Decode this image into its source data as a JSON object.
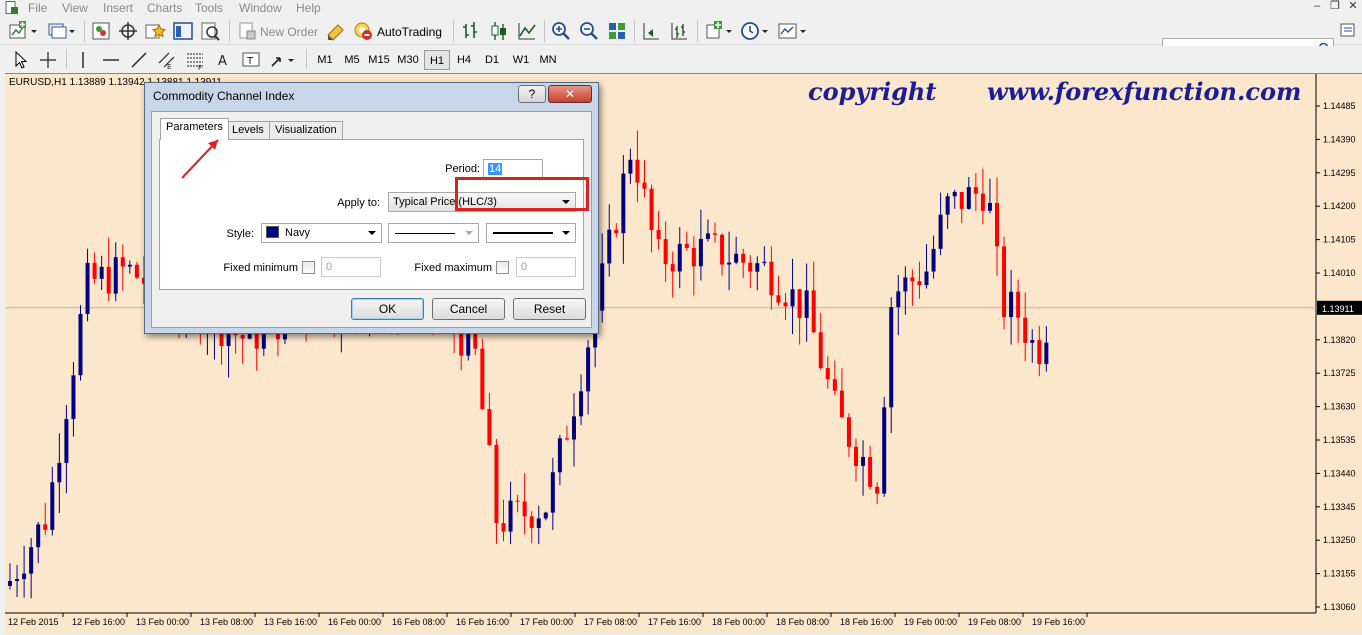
{
  "menu": {
    "items": [
      "File",
      "View",
      "Insert",
      "Charts",
      "Tools",
      "Window",
      "Help"
    ]
  },
  "window_controls": {
    "minimize": "–",
    "restore": "❐",
    "close": "✕"
  },
  "toolbar": {
    "new_order": "New Order",
    "autotrading": "AutoTrading"
  },
  "timeframes": [
    "M1",
    "M5",
    "M15",
    "M30",
    "H1",
    "H4",
    "D1",
    "W1",
    "MN"
  ],
  "active_timeframe": "H1",
  "search": {
    "placeholder": ""
  },
  "chart": {
    "symbol_line": "EURUSD,H1  1.13889 1.13942 1.13881 1.13911",
    "watermark_left": "copyright",
    "watermark_right": "www.forexfunction.com",
    "price_labels": [
      "1.14485",
      "1.14390",
      "1.14295",
      "1.14200",
      "1.14105",
      "1.14010",
      "1.13911",
      "1.13820",
      "1.13725",
      "1.13630",
      "1.13535",
      "1.13440",
      "1.13345",
      "1.13250",
      "1.13155",
      "1.13060"
    ],
    "current_price": "1.13911",
    "time_labels": [
      "12 Feb 2015",
      "12 Feb 16:00",
      "13 Feb 00:00",
      "13 Feb 08:00",
      "13 Feb 16:00",
      "16 Feb 00:00",
      "16 Feb 08:00",
      "16 Feb 16:00",
      "17 Feb 00:00",
      "17 Feb 08:00",
      "17 Feb 16:00",
      "18 Feb 00:00",
      "18 Feb 08:00",
      "18 Feb 16:00",
      "19 Feb 00:00",
      "19 Feb 08:00",
      "19 Feb 16:00"
    ],
    "colors": {
      "bull": "#000080",
      "bear": "#ff0000",
      "background": "#fbe7cc",
      "text": "#1c1c96"
    }
  },
  "dialog": {
    "title": "Commodity Channel Index",
    "help_label": "?",
    "close_label": "✕",
    "tabs": [
      "Parameters",
      "Levels",
      "Visualization"
    ],
    "active_tab": "Parameters",
    "period_label": "Period:",
    "period_value": "14",
    "apply_to_label": "Apply to:",
    "apply_to_value": "Typical Price (HLC/3)",
    "style_label": "Style:",
    "style_color_name": "Navy",
    "style_color": "#000080",
    "fixed_min_label": "Fixed minimum",
    "fixed_min_value": "0",
    "fixed_max_label": "Fixed maximum",
    "fixed_max_value": "0",
    "ok_label": "OK",
    "cancel_label": "Cancel",
    "reset_label": "Reset"
  }
}
